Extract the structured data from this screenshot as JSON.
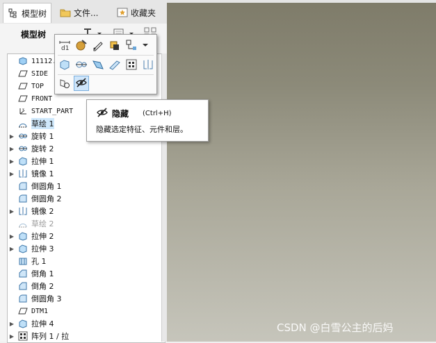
{
  "tabs": [
    {
      "label": "模型树",
      "icon": "model-tree-icon"
    },
    {
      "label": "文件...",
      "icon": "folder-icon"
    },
    {
      "label": "收藏夹",
      "icon": "favorites-icon"
    }
  ],
  "toolbar": {
    "title": "模型树"
  },
  "tree": [
    {
      "label": "11112.P",
      "icon": "part-icon",
      "expand": false,
      "mono": true
    },
    {
      "label": "SIDE",
      "icon": "datum-plane-icon",
      "expand": false,
      "mono": true
    },
    {
      "label": "TOP",
      "icon": "datum-plane-icon",
      "expand": false,
      "mono": true
    },
    {
      "label": "FRONT",
      "icon": "datum-plane-icon",
      "expand": false,
      "mono": true
    },
    {
      "label": "START_PART",
      "icon": "csys-icon",
      "expand": false,
      "mono": true
    },
    {
      "label": "草绘 1",
      "icon": "sketch-icon",
      "expand": false,
      "selected": true
    },
    {
      "label": "旋转 1",
      "icon": "revolve-icon",
      "expand": true
    },
    {
      "label": "旋转 2",
      "icon": "revolve-icon",
      "expand": true
    },
    {
      "label": "拉伸 1",
      "icon": "extrude-icon",
      "expand": true
    },
    {
      "label": "镜像 1",
      "icon": "mirror-icon",
      "expand": true
    },
    {
      "label": "倒圆角 1",
      "icon": "round-icon",
      "expand": false
    },
    {
      "label": "倒圆角 2",
      "icon": "round-icon",
      "expand": false
    },
    {
      "label": "镜像 2",
      "icon": "mirror-icon",
      "expand": true
    },
    {
      "label": "草绘 2",
      "icon": "sketch-icon",
      "expand": false,
      "dim": true
    },
    {
      "label": "拉伸 2",
      "icon": "extrude-icon",
      "expand": true
    },
    {
      "label": "拉伸 3",
      "icon": "extrude-icon",
      "expand": true
    },
    {
      "label": "孔 1",
      "icon": "hole-icon",
      "expand": false
    },
    {
      "label": "倒角 1",
      "icon": "chamfer-icon",
      "expand": false
    },
    {
      "label": "倒角 2",
      "icon": "chamfer-icon",
      "expand": false
    },
    {
      "label": "倒圆角 3",
      "icon": "round-icon",
      "expand": false
    },
    {
      "label": "DTM1",
      "icon": "datum-plane-icon",
      "expand": false,
      "mono": true
    },
    {
      "label": "拉伸 4",
      "icon": "extrude-icon",
      "expand": true
    },
    {
      "label": "阵列 1 / 拉",
      "icon": "pattern-icon",
      "expand": true
    }
  ],
  "tooltip": {
    "title": "隐藏",
    "shortcut": "(Ctrl+H)",
    "description": "隐藏选定特征、元件和层。"
  },
  "watermark": "CSDN @白雪公主的后妈"
}
